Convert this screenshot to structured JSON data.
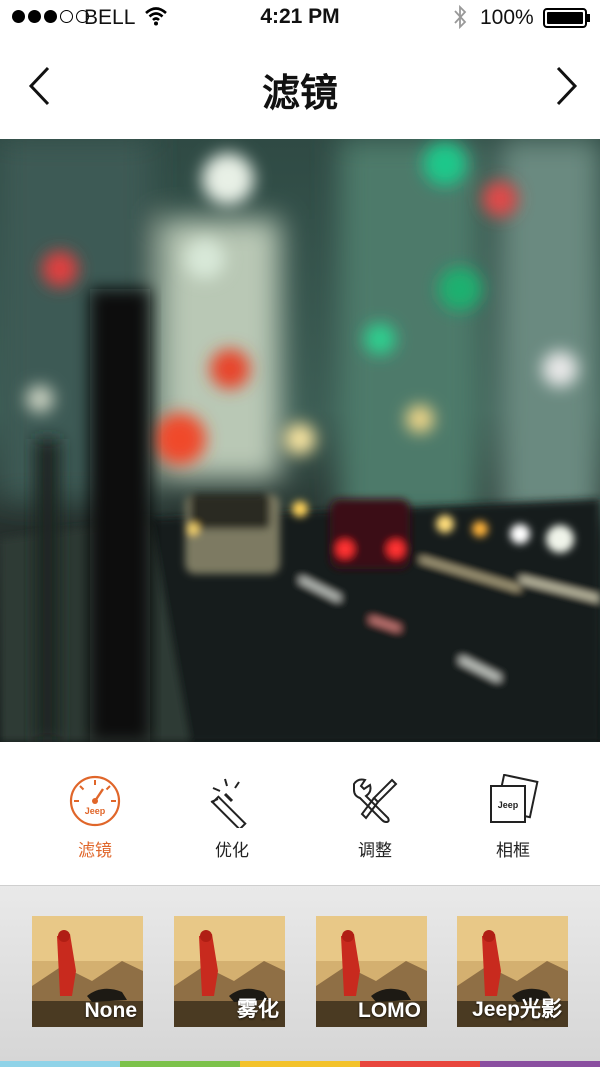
{
  "status_bar": {
    "carrier": "BELL",
    "time": "4:21 PM",
    "battery": "100%"
  },
  "nav": {
    "title": "滤镜",
    "back_icon": "chevron-left-icon",
    "forward_icon": "chevron-right-icon"
  },
  "tabs": [
    {
      "label": "滤镜",
      "icon": "gauge-icon",
      "active": true
    },
    {
      "label": "优化",
      "icon": "magic-wand-icon",
      "active": false
    },
    {
      "label": "调整",
      "icon": "wrench-icon",
      "active": false
    },
    {
      "label": "相框",
      "icon": "frame-icon",
      "active": false
    }
  ],
  "filters": [
    {
      "label": "None"
    },
    {
      "label": "雾化"
    },
    {
      "label": "LOMO"
    },
    {
      "label": "Jeep光影"
    }
  ],
  "colors": {
    "accent": "#e0662a",
    "stripe": [
      "#8fd3e8",
      "#7cc24a",
      "#f3c22b",
      "#e8453c",
      "#8a4fa0"
    ]
  },
  "brand_badge": "Jeep"
}
